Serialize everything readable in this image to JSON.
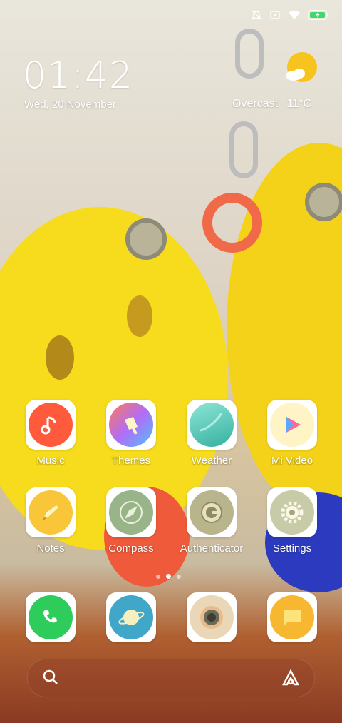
{
  "status_bar": {
    "icons": [
      "bell-off-icon",
      "sim-missing-icon",
      "wifi-icon",
      "battery-charging-icon"
    ]
  },
  "clock": {
    "time": "01:42",
    "date": "Wed, 20 November"
  },
  "weather": {
    "condition": "Overcast",
    "temp": "11°C",
    "icon": "partly-cloudy-icon"
  },
  "apps": [
    {
      "label": "Music",
      "icon": "music-note-icon"
    },
    {
      "label": "Themes",
      "icon": "paint-brush-icon"
    },
    {
      "label": "Weather",
      "icon": "weather-icon"
    },
    {
      "label": "Mi Video",
      "icon": "play-icon"
    },
    {
      "label": "Notes",
      "icon": "pencil-icon"
    },
    {
      "label": "Compass",
      "icon": "compass-icon"
    },
    {
      "label": "Authenticator",
      "icon": "key-dial-icon"
    },
    {
      "label": "Settings",
      "icon": "gear-icon"
    }
  ],
  "dock": [
    {
      "icon": "phone-icon"
    },
    {
      "icon": "browser-planet-icon"
    },
    {
      "icon": "camera-icon"
    },
    {
      "icon": "messages-icon"
    }
  ],
  "page_indicator": {
    "pages": 3,
    "current": 2
  },
  "colors": {
    "accent_yellow": "#f5d52b",
    "phone_green": "#2ecc5a",
    "music_red": "#ff5a3c"
  }
}
